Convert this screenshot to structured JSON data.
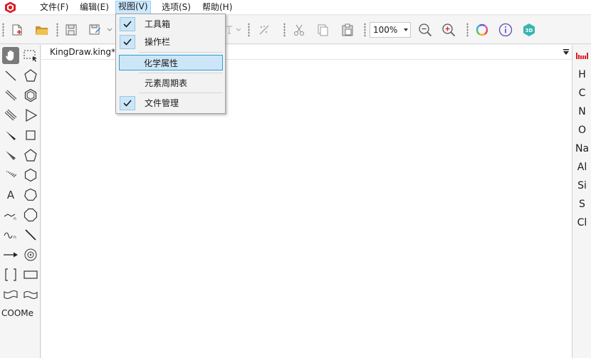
{
  "menubar": {
    "items": [
      "文件(F)",
      "编辑(E)",
      "视图(V)",
      "选项(S)",
      "帮助(H)"
    ],
    "active_index": 2
  },
  "view_menu": {
    "items": [
      {
        "label": "工具箱",
        "checked": true
      },
      {
        "label": "操作栏",
        "checked": true
      },
      {
        "label": "化学属性",
        "checked": false,
        "highlighted": true
      },
      {
        "label": "元素周期表",
        "checked": false
      },
      {
        "label": "文件管理",
        "checked": true
      }
    ]
  },
  "toolbar": {
    "zoom_value": "100%",
    "icons": [
      "new-file-icon",
      "open-folder-icon",
      "save-icon",
      "save-as-icon",
      "dropdown-icon",
      "clean-structure-icon",
      "cut-icon",
      "copy-icon",
      "paste-icon",
      "zoom-out-icon",
      "zoom-in-icon",
      "color-wheel-icon",
      "info-icon",
      "3d-view-icon"
    ],
    "brand_color": "#d81e28"
  },
  "document": {
    "tab_title": "KingDraw.king*"
  },
  "left_tools": {
    "text_tool_label": "A",
    "group_label": "COOMe"
  },
  "elements": [
    "H",
    "C",
    "N",
    "O",
    "Na",
    "Al",
    "Si",
    "S",
    "Cl"
  ]
}
